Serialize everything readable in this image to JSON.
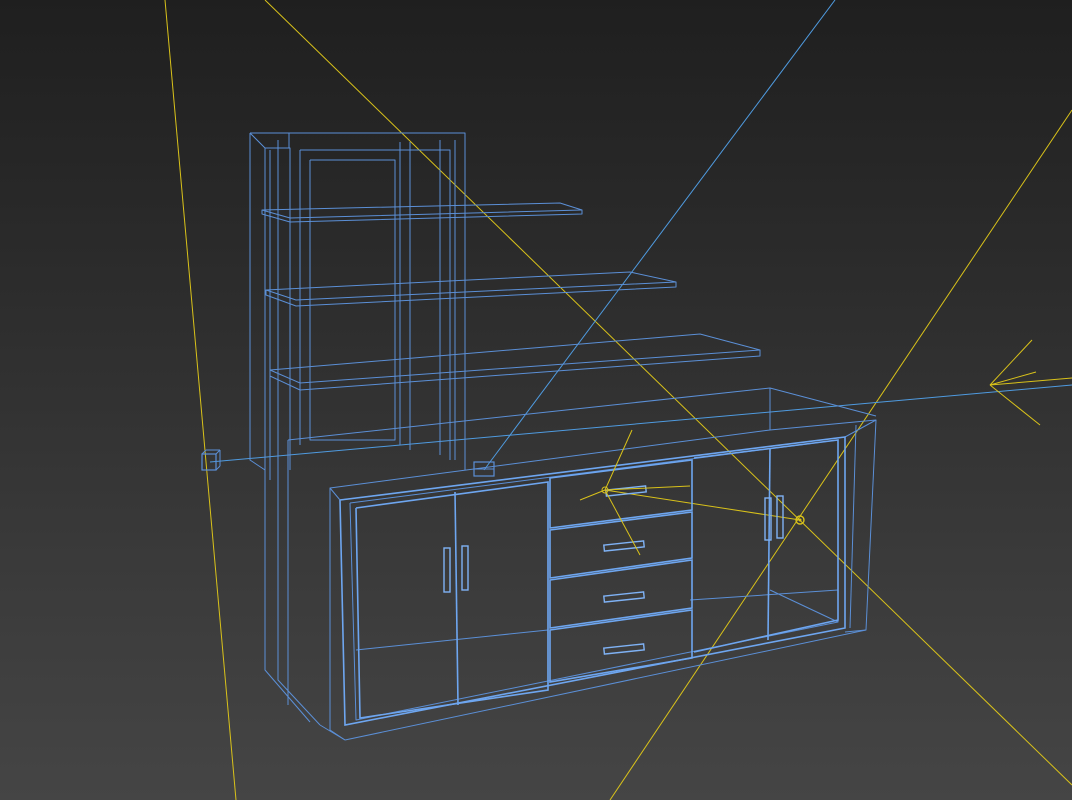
{
  "viewport": {
    "mode": "wireframe",
    "background_top": "#1f1f1f",
    "background_bottom": "#454545"
  },
  "colors": {
    "wireframe": "#5b8fd6",
    "wireframe_highlight": "#6ea6f0",
    "light_guides": "#d9c21a",
    "camera_guides": "#4f9be0"
  },
  "scene_objects": {
    "model": "cabinet-with-shelves",
    "lights": [
      "target-light",
      "spot-light"
    ],
    "helpers": [
      "camera-target-cube",
      "camera-target-marker"
    ]
  }
}
